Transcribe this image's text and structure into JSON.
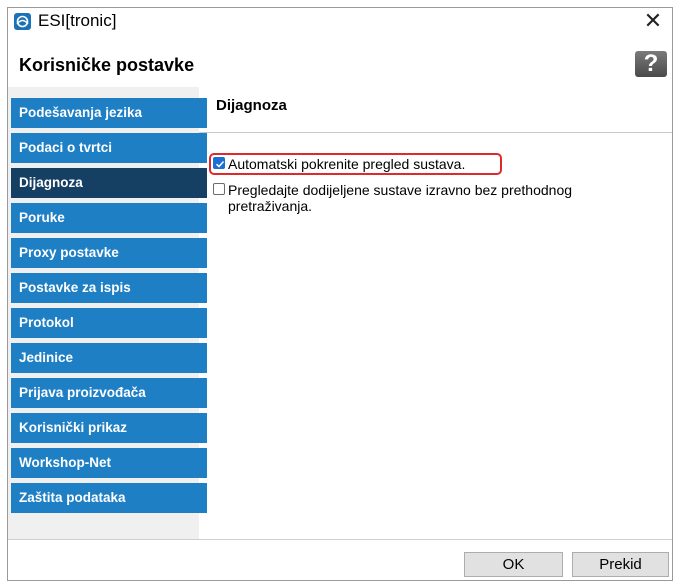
{
  "window": {
    "title": "ESI[tronic]",
    "close_symbol": "✕"
  },
  "header": {
    "title": "Korisničke postavke",
    "help_symbol": "?"
  },
  "sidebar": {
    "items": [
      {
        "label": "Podešavanja jezika"
      },
      {
        "label": "Podaci o tvrtci"
      },
      {
        "label": "Dijagnoza"
      },
      {
        "label": "Poruke"
      },
      {
        "label": "Proxy postavke"
      },
      {
        "label": "Postavke za ispis"
      },
      {
        "label": "Protokol"
      },
      {
        "label": "Jedinice"
      },
      {
        "label": "Prijava proizvođača"
      },
      {
        "label": "Korisnički prikaz"
      },
      {
        "label": "Workshop-Net"
      },
      {
        "label": "Zaštita podataka"
      }
    ],
    "active": "Dijagnoza"
  },
  "main": {
    "section_title": "Dijagnoza",
    "options": [
      {
        "label": "Automatski pokrenite pregled sustava.",
        "checked": true
      },
      {
        "label_line1": "Pregledajte dodijeljene sustave izravno bez prethodnog",
        "label_line2": "pretraživanja.",
        "checked": false
      }
    ]
  },
  "footer": {
    "ok_label": "OK",
    "cancel_label": "Prekid"
  },
  "colors": {
    "nav_item": "#1e7fc5",
    "nav_item_active": "#153f63",
    "highlight": "#e0292a",
    "checkbox_checked": "#1a6fd4"
  }
}
